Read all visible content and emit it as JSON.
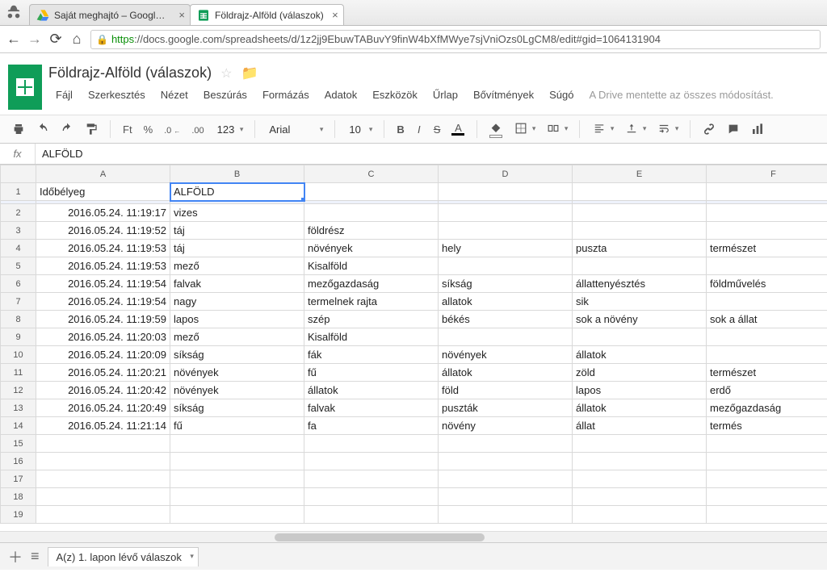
{
  "browser": {
    "tabs": [
      {
        "title": "Saját meghajtó – Google D"
      },
      {
        "title": "Földrajz-Alföld (válaszok)"
      }
    ],
    "url_https": "https",
    "url_rest": "://docs.google.com/spreadsheets/d/1z2jj9EbuwTABuvY9finW4bXfMWye7sjVniOzs0LgCM8/edit#gid=1064131904"
  },
  "doc": {
    "title": "Földrajz-Alföld (válaszok)",
    "autosave": "A Drive mentette az összes módosítást."
  },
  "menu": [
    "Fájl",
    "Szerkesztés",
    "Nézet",
    "Beszúrás",
    "Formázás",
    "Adatok",
    "Eszközök",
    "Űrlap",
    "Bővítmények",
    "Súgó"
  ],
  "toolbar": {
    "currency": "Ft",
    "percent": "%",
    "dec_dec": ".0",
    "dec_inc": ".00",
    "numfmt": "123",
    "font": "Arial",
    "size": "10"
  },
  "fx": {
    "label": "fx",
    "value": "ALFÖLD"
  },
  "cols": [
    "A",
    "B",
    "C",
    "D",
    "E",
    "F"
  ],
  "rows": [
    {
      "n": "1",
      "A": "Időbélyeg",
      "B": "ALFÖLD",
      "C": "",
      "D": "",
      "E": "",
      "F": ""
    },
    {
      "n": "2",
      "A": "2016.05.24. 11:19:17",
      "B": "vizes",
      "C": "",
      "D": "",
      "E": "",
      "F": ""
    },
    {
      "n": "3",
      "A": "2016.05.24. 11:19:52",
      "B": "táj",
      "C": "földrész",
      "D": "",
      "E": "",
      "F": ""
    },
    {
      "n": "4",
      "A": "2016.05.24. 11:19:53",
      "B": "táj",
      "C": "növények",
      "D": "hely",
      "E": "puszta",
      "F": "természet"
    },
    {
      "n": "5",
      "A": "2016.05.24. 11:19:53",
      "B": "mező",
      "C": "Kisalföld",
      "D": "",
      "E": "",
      "F": ""
    },
    {
      "n": "6",
      "A": "2016.05.24. 11:19:54",
      "B": "falvak",
      "C": "mezőgazdaság",
      "D": "síkság",
      "E": "állattenyésztés",
      "F": "földművelés"
    },
    {
      "n": "7",
      "A": "2016.05.24. 11:19:54",
      "B": "nagy",
      "C": "termelnek rajta",
      "D": "allatok",
      "E": "sik",
      "F": ""
    },
    {
      "n": "8",
      "A": "2016.05.24. 11:19:59",
      "B": "lapos",
      "C": "szép",
      "D": "békés",
      "E": "sok a növény",
      "F": "sok a állat"
    },
    {
      "n": "9",
      "A": "2016.05.24. 11:20:03",
      "B": "mező",
      "C": "Kisalföld",
      "D": "",
      "E": "",
      "F": ""
    },
    {
      "n": "10",
      "A": "2016.05.24. 11:20:09",
      "B": "síkság",
      "C": "fák",
      "D": "növények",
      "E": "állatok",
      "F": ""
    },
    {
      "n": "11",
      "A": "2016.05.24. 11:20:21",
      "B": "növények",
      "C": "fű",
      "D": "állatok",
      "E": "zöld",
      "F": "természet"
    },
    {
      "n": "12",
      "A": "2016.05.24. 11:20:42",
      "B": "növények",
      "C": "állatok",
      "D": "föld",
      "E": "lapos",
      "F": "erdő"
    },
    {
      "n": "13",
      "A": "2016.05.24. 11:20:49",
      "B": "síkság",
      "C": "falvak",
      "D": "puszták",
      "E": "állatok",
      "F": "mezőgazdaság"
    },
    {
      "n": "14",
      "A": "2016.05.24. 11:21:14",
      "B": "fű",
      "C": "fa",
      "D": "növény",
      "E": "állat",
      "F": "termés"
    },
    {
      "n": "15",
      "A": "",
      "B": "",
      "C": "",
      "D": "",
      "E": "",
      "F": ""
    },
    {
      "n": "16",
      "A": "",
      "B": "",
      "C": "",
      "D": "",
      "E": "",
      "F": ""
    },
    {
      "n": "17",
      "A": "",
      "B": "",
      "C": "",
      "D": "",
      "E": "",
      "F": ""
    },
    {
      "n": "18",
      "A": "",
      "B": "",
      "C": "",
      "D": "",
      "E": "",
      "F": ""
    },
    {
      "n": "19",
      "A": "",
      "B": "",
      "C": "",
      "D": "",
      "E": "",
      "F": ""
    }
  ],
  "selected_cell": "B1",
  "sheet_tab": "A(z) 1. lapon lévő válaszok"
}
